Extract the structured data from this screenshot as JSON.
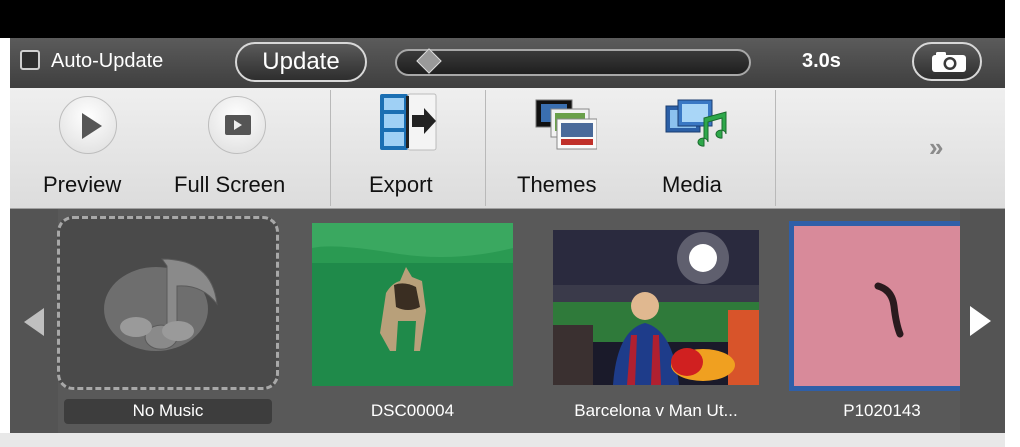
{
  "controls": {
    "auto_update_label": "Auto-Update",
    "auto_update_checked": false,
    "update_button": "Update",
    "duration_label": "3.0s",
    "slider_fraction": 0.05,
    "camera_icon": "camera-icon"
  },
  "toolbar": {
    "items": [
      {
        "label": "Preview",
        "icon": "play-icon"
      },
      {
        "label": "Full Screen",
        "icon": "fullscreen-icon"
      },
      {
        "label": "Export",
        "icon": "export-icon"
      },
      {
        "label": "Themes",
        "icon": "themes-icon"
      },
      {
        "label": "Media",
        "icon": "media-icon"
      }
    ],
    "more_icon": "double-chevron-right-icon"
  },
  "media": {
    "items": [
      {
        "label": "No Music",
        "kind": "music-placeholder"
      },
      {
        "label": "DSC00004",
        "kind": "photo"
      },
      {
        "label": "Barcelona v Man Ut...",
        "kind": "photo"
      },
      {
        "label": "P1020143",
        "kind": "photo",
        "selected": true
      }
    ]
  },
  "colors": {
    "selection_border": "#2f5fa8",
    "toolbar_bg": "#e6e6e6",
    "strip_bg": "#595959"
  }
}
